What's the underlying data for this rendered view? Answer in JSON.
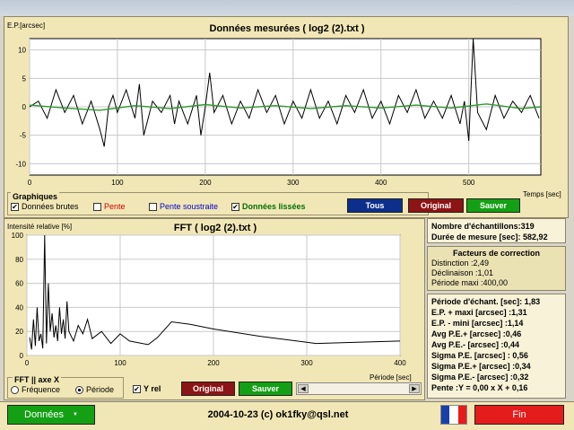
{
  "top_chart": {
    "title": "Données mesurées ( log2 (2).txt )",
    "ylabel": "E.P.[arcsec]",
    "xlabel": "Temps [sec]",
    "y_ticks": [
      "10",
      "5",
      "0",
      "-5",
      "-10"
    ],
    "x_ticks": [
      "0",
      "100",
      "200",
      "300",
      "400",
      "500"
    ],
    "raw_color": "#000000",
    "smooth_color": "#2e9a2e"
  },
  "graph_options": {
    "group_label": "Graphiques",
    "raw_label": "Données brutes",
    "raw_checked": "✔",
    "slope_label": "Pente",
    "slope_sub_label": "Pente soustraite",
    "smooth_label": "Données lissées",
    "smooth_checked": "✔",
    "btn_all": "Tous",
    "btn_original": "Original",
    "btn_save": "Sauver",
    "slope_color": "#d00000",
    "slope_sub_color": "#0000cc",
    "smooth_text_color": "#007000"
  },
  "fft_chart": {
    "title": "FFT ( log2 (2).txt )",
    "ylabel": "Intensité relative [%]",
    "xlabel": "Période [sec]",
    "y_ticks": [
      "100",
      "80",
      "60",
      "40",
      "20",
      "0"
    ],
    "x_ticks": [
      "0",
      "100",
      "200",
      "300",
      "400"
    ]
  },
  "fft_options": {
    "axis_group": "FFT || axe X",
    "freq_label": "Fréquence",
    "period_label": "Période",
    "yrel_label": "Y rel",
    "yrel_checked": "✔",
    "btn_original": "Original",
    "btn_save": "Sauver"
  },
  "stats": {
    "samples": "Nombre d'échantillons:319",
    "duration": "Durée de mesure [sec]: 582,92"
  },
  "correction": {
    "title1": "Facteurs de correction",
    "distinction": "Distinction :2,49",
    "declinaison": "Déclinaison :1,01",
    "periode": "Période maxi :400,00"
  },
  "details": [
    "Période d'échant. [sec]: 1,83",
    "E.P. + maxi [arcsec] :1,31",
    "E.P. - mini [arcsec] :1,14",
    "Avg P.E.+ [arcsec] :0,46",
    "Avg P.E.- [arcsec] :0,44",
    "Sigma P.E. [arcsec] : 0,56",
    "Sigma P.E.+ [arcsec] :0,34",
    "Sigma P.E.- [arcsec] :0,32",
    "Pente :Y = 0,00 x X + 0,16"
  ],
  "bottom_bar": {
    "data_btn": "Données",
    "footer_text": "2004-10-23 (c) ok1fky@qsl.net",
    "end_btn": "Fin",
    "green": "#14a014",
    "red": "#e41c1c"
  },
  "chart_data": [
    {
      "type": "line",
      "title": "Données mesurées ( log2 (2).txt )",
      "xlabel": "Temps [sec]",
      "ylabel": "E.P.[arcsec]",
      "xlim": [
        0,
        582
      ],
      "ylim": [
        -12,
        12
      ],
      "series": [
        {
          "name": "Données brutes",
          "x": [
            0,
            10,
            20,
            30,
            40,
            50,
            60,
            70,
            80,
            85,
            90,
            95,
            100,
            110,
            120,
            125,
            130,
            140,
            150,
            160,
            165,
            170,
            180,
            190,
            195,
            200,
            205,
            210,
            220,
            230,
            240,
            250,
            260,
            270,
            280,
            290,
            300,
            310,
            320,
            330,
            340,
            350,
            360,
            370,
            380,
            390,
            400,
            410,
            420,
            430,
            440,
            450,
            460,
            470,
            480,
            490,
            495,
            500,
            505,
            510,
            520,
            530,
            540,
            550,
            560,
            570,
            580
          ],
          "y": [
            0,
            1,
            -2,
            3,
            -1,
            2,
            -3,
            1,
            -4,
            -7,
            0,
            2,
            -1,
            3,
            -2,
            4,
            -5,
            1,
            -1,
            2,
            -3,
            1,
            -3,
            2,
            -5,
            0,
            6,
            -1,
            2,
            -3,
            1,
            -2,
            3,
            -1,
            2,
            -3,
            1,
            -2,
            3,
            -2,
            1,
            -3,
            2,
            -1,
            3,
            -2,
            1,
            -3,
            2,
            -1,
            3,
            -2,
            1,
            -2,
            2,
            -3,
            1,
            -6,
            12,
            -1,
            -4,
            2,
            -2,
            1,
            -1,
            2,
            -2
          ]
        },
        {
          "name": "Données lissées",
          "x": [
            0,
            40,
            80,
            120,
            160,
            200,
            240,
            280,
            320,
            360,
            400,
            440,
            480,
            520,
            560,
            582
          ],
          "y": [
            0.3,
            -0.2,
            -0.6,
            0.2,
            -0.3,
            0.4,
            -0.2,
            0.2,
            -0.3,
            0.2,
            -0.2,
            0.3,
            -0.2,
            0.5,
            -0.3,
            0.0
          ]
        }
      ]
    },
    {
      "type": "line",
      "title": "FFT ( log2 (2).txt )",
      "xlabel": "Période [sec]",
      "ylabel": "Intensité relative [%]",
      "xlim": [
        0,
        400
      ],
      "ylim": [
        0,
        100
      ],
      "series": [
        {
          "name": "FFT",
          "x": [
            3,
            5,
            7,
            9,
            11,
            13,
            15,
            17,
            19,
            21,
            23,
            25,
            27,
            29,
            31,
            33,
            35,
            37,
            39,
            41,
            43,
            45,
            50,
            55,
            60,
            65,
            70,
            80,
            90,
            100,
            110,
            130,
            140,
            155,
            175,
            200,
            250,
            310,
            400
          ],
          "y": [
            15,
            5,
            30,
            8,
            40,
            12,
            18,
            6,
            100,
            10,
            60,
            20,
            35,
            15,
            25,
            12,
            40,
            18,
            30,
            14,
            45,
            20,
            12,
            25,
            18,
            30,
            14,
            20,
            10,
            18,
            12,
            9,
            15,
            28,
            26,
            22,
            16,
            10,
            12
          ]
        }
      ]
    }
  ]
}
